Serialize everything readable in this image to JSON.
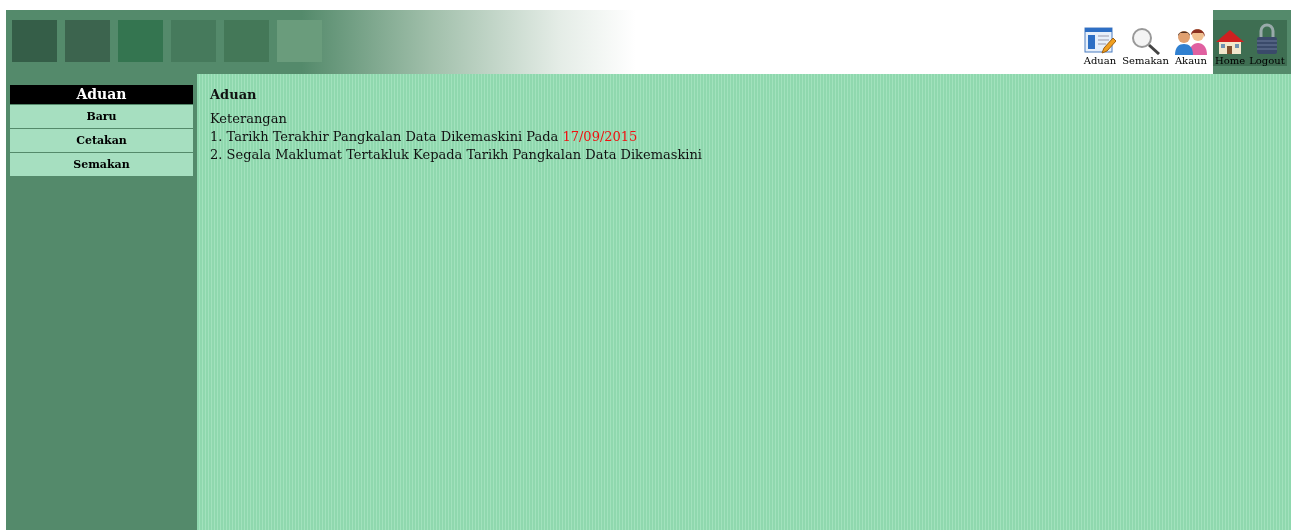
{
  "toolbar": [
    {
      "label": "Aduan",
      "kind": "document"
    },
    {
      "label": "Semakan",
      "kind": "search"
    },
    {
      "label": "Akaun",
      "kind": "people"
    }
  ],
  "system_links": [
    {
      "label": "Home",
      "kind": "house"
    },
    {
      "label": "Logout",
      "kind": "lock"
    }
  ],
  "sidebar": {
    "title": "Aduan",
    "items": [
      "Baru",
      "Cetakan",
      "Semakan"
    ]
  },
  "content": {
    "heading": "Aduan",
    "subheading": "Keterangan",
    "lines": [
      {
        "text": "1. Tarikh Terakhir Pangkalan Data Dikemaskini Pada",
        "date": "17/09/2015"
      },
      {
        "text": "2. Segala Maklumat Tertakluk Kepada Tarikh Pangkalan Data Dikemaskini"
      }
    ]
  }
}
